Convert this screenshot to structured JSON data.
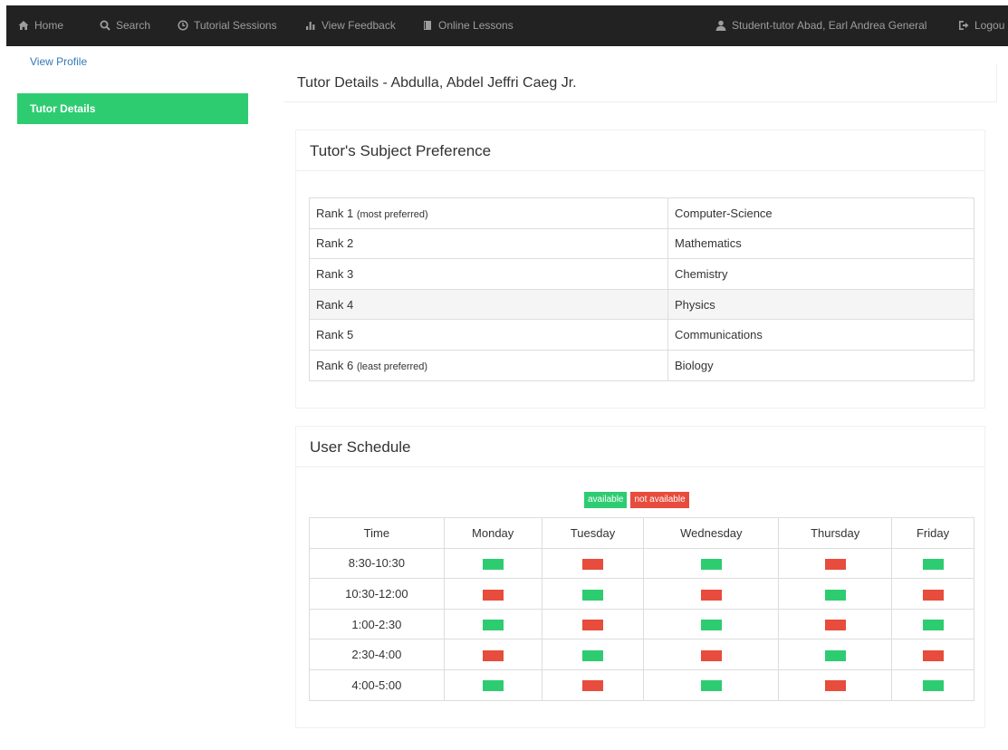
{
  "navbar": {
    "home": "Home",
    "search": "Search",
    "tutorial_sessions": "Tutorial Sessions",
    "view_feedback": "View Feedback",
    "online_lessons": "Online Lessons",
    "user": "Student-tutor Abad, Earl Andrea General",
    "logout": "Logou"
  },
  "sidebar": {
    "view_profile": "View Profile",
    "tutor_details": "Tutor Details"
  },
  "page_title": "Tutor Details - Abdulla, Abdel Jeffri Caeg Jr.",
  "preference": {
    "heading": "Tutor's Subject Preference",
    "rows": [
      {
        "rank": "Rank 1",
        "note": "(most preferred)",
        "subject": "Computer-Science"
      },
      {
        "rank": "Rank 2",
        "note": "",
        "subject": "Mathematics"
      },
      {
        "rank": "Rank 3",
        "note": "",
        "subject": "Chemistry"
      },
      {
        "rank": "Rank 4",
        "note": "",
        "subject": "Physics"
      },
      {
        "rank": "Rank 5",
        "note": "",
        "subject": "Communications"
      },
      {
        "rank": "Rank 6",
        "note": "(least preferred)",
        "subject": "Biology"
      }
    ]
  },
  "schedule": {
    "heading": "User Schedule",
    "legend": {
      "available": "available",
      "not_available": "not available"
    },
    "columns": [
      "Time",
      "Monday",
      "Tuesday",
      "Wednesday",
      "Thursday",
      "Friday"
    ],
    "rows": [
      {
        "time": "8:30-10:30",
        "status": [
          "available",
          "not available",
          "available",
          "not available",
          "available"
        ]
      },
      {
        "time": "10:30-12:00",
        "status": [
          "not available",
          "available",
          "not available",
          "available",
          "not available"
        ]
      },
      {
        "time": "1:00-2:30",
        "status": [
          "available",
          "not available",
          "available",
          "not available",
          "available"
        ]
      },
      {
        "time": "2:30-4:00",
        "status": [
          "not available",
          "available",
          "not available",
          "available",
          "not available"
        ]
      },
      {
        "time": "4:00-5:00",
        "status": [
          "available",
          "not available",
          "available",
          "not available",
          "available"
        ]
      }
    ]
  },
  "colors": {
    "navbar": "#222222",
    "accent_green": "#2ecc71",
    "red": "#e74c3c",
    "link": "#337ab7"
  }
}
